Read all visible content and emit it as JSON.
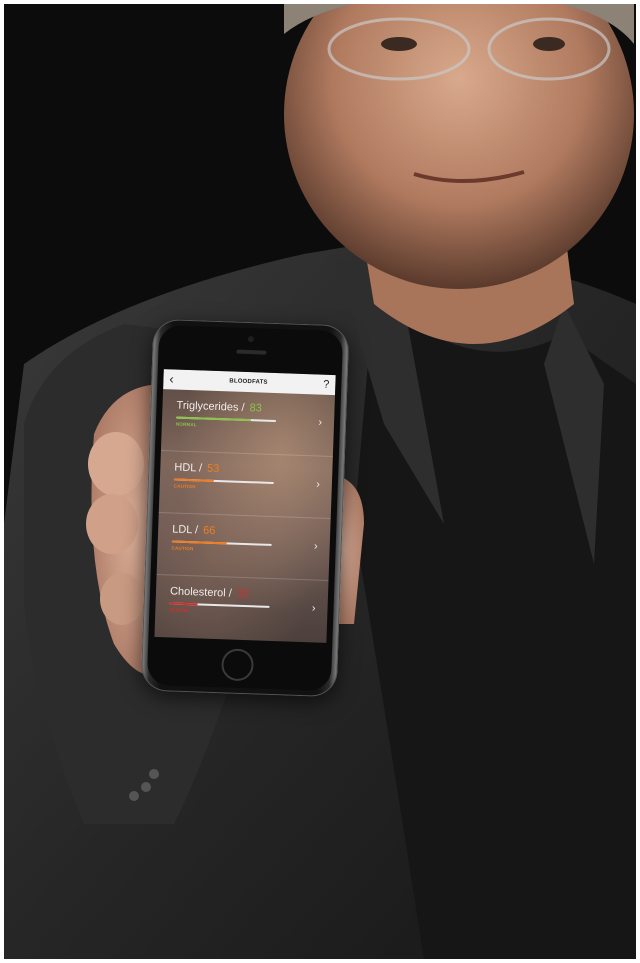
{
  "screen": {
    "nav": {
      "back_icon": "chevron-left-icon",
      "back_glyph": "‹",
      "title": "BLOODFATS",
      "help_label": "?"
    },
    "rows": [
      {
        "name": "Triglycerides",
        "sep": " / ",
        "value": "83",
        "status": "NORMAL",
        "level": 0.75,
        "color": "#8bc34a"
      },
      {
        "name": "HDL",
        "sep": " / ",
        "value": "53",
        "status": "CAUTION",
        "level": 0.4,
        "color": "#f07d22"
      },
      {
        "name": "LDL",
        "sep": " / ",
        "value": "66",
        "status": "CAUTION",
        "level": 0.55,
        "color": "#f07d22"
      },
      {
        "name": "Cholesterol",
        "sep": " / ",
        "value": "32",
        "status": "SEVERE",
        "level": 0.28,
        "color": "#d32f2f"
      }
    ],
    "chevron_glyph": "›"
  }
}
